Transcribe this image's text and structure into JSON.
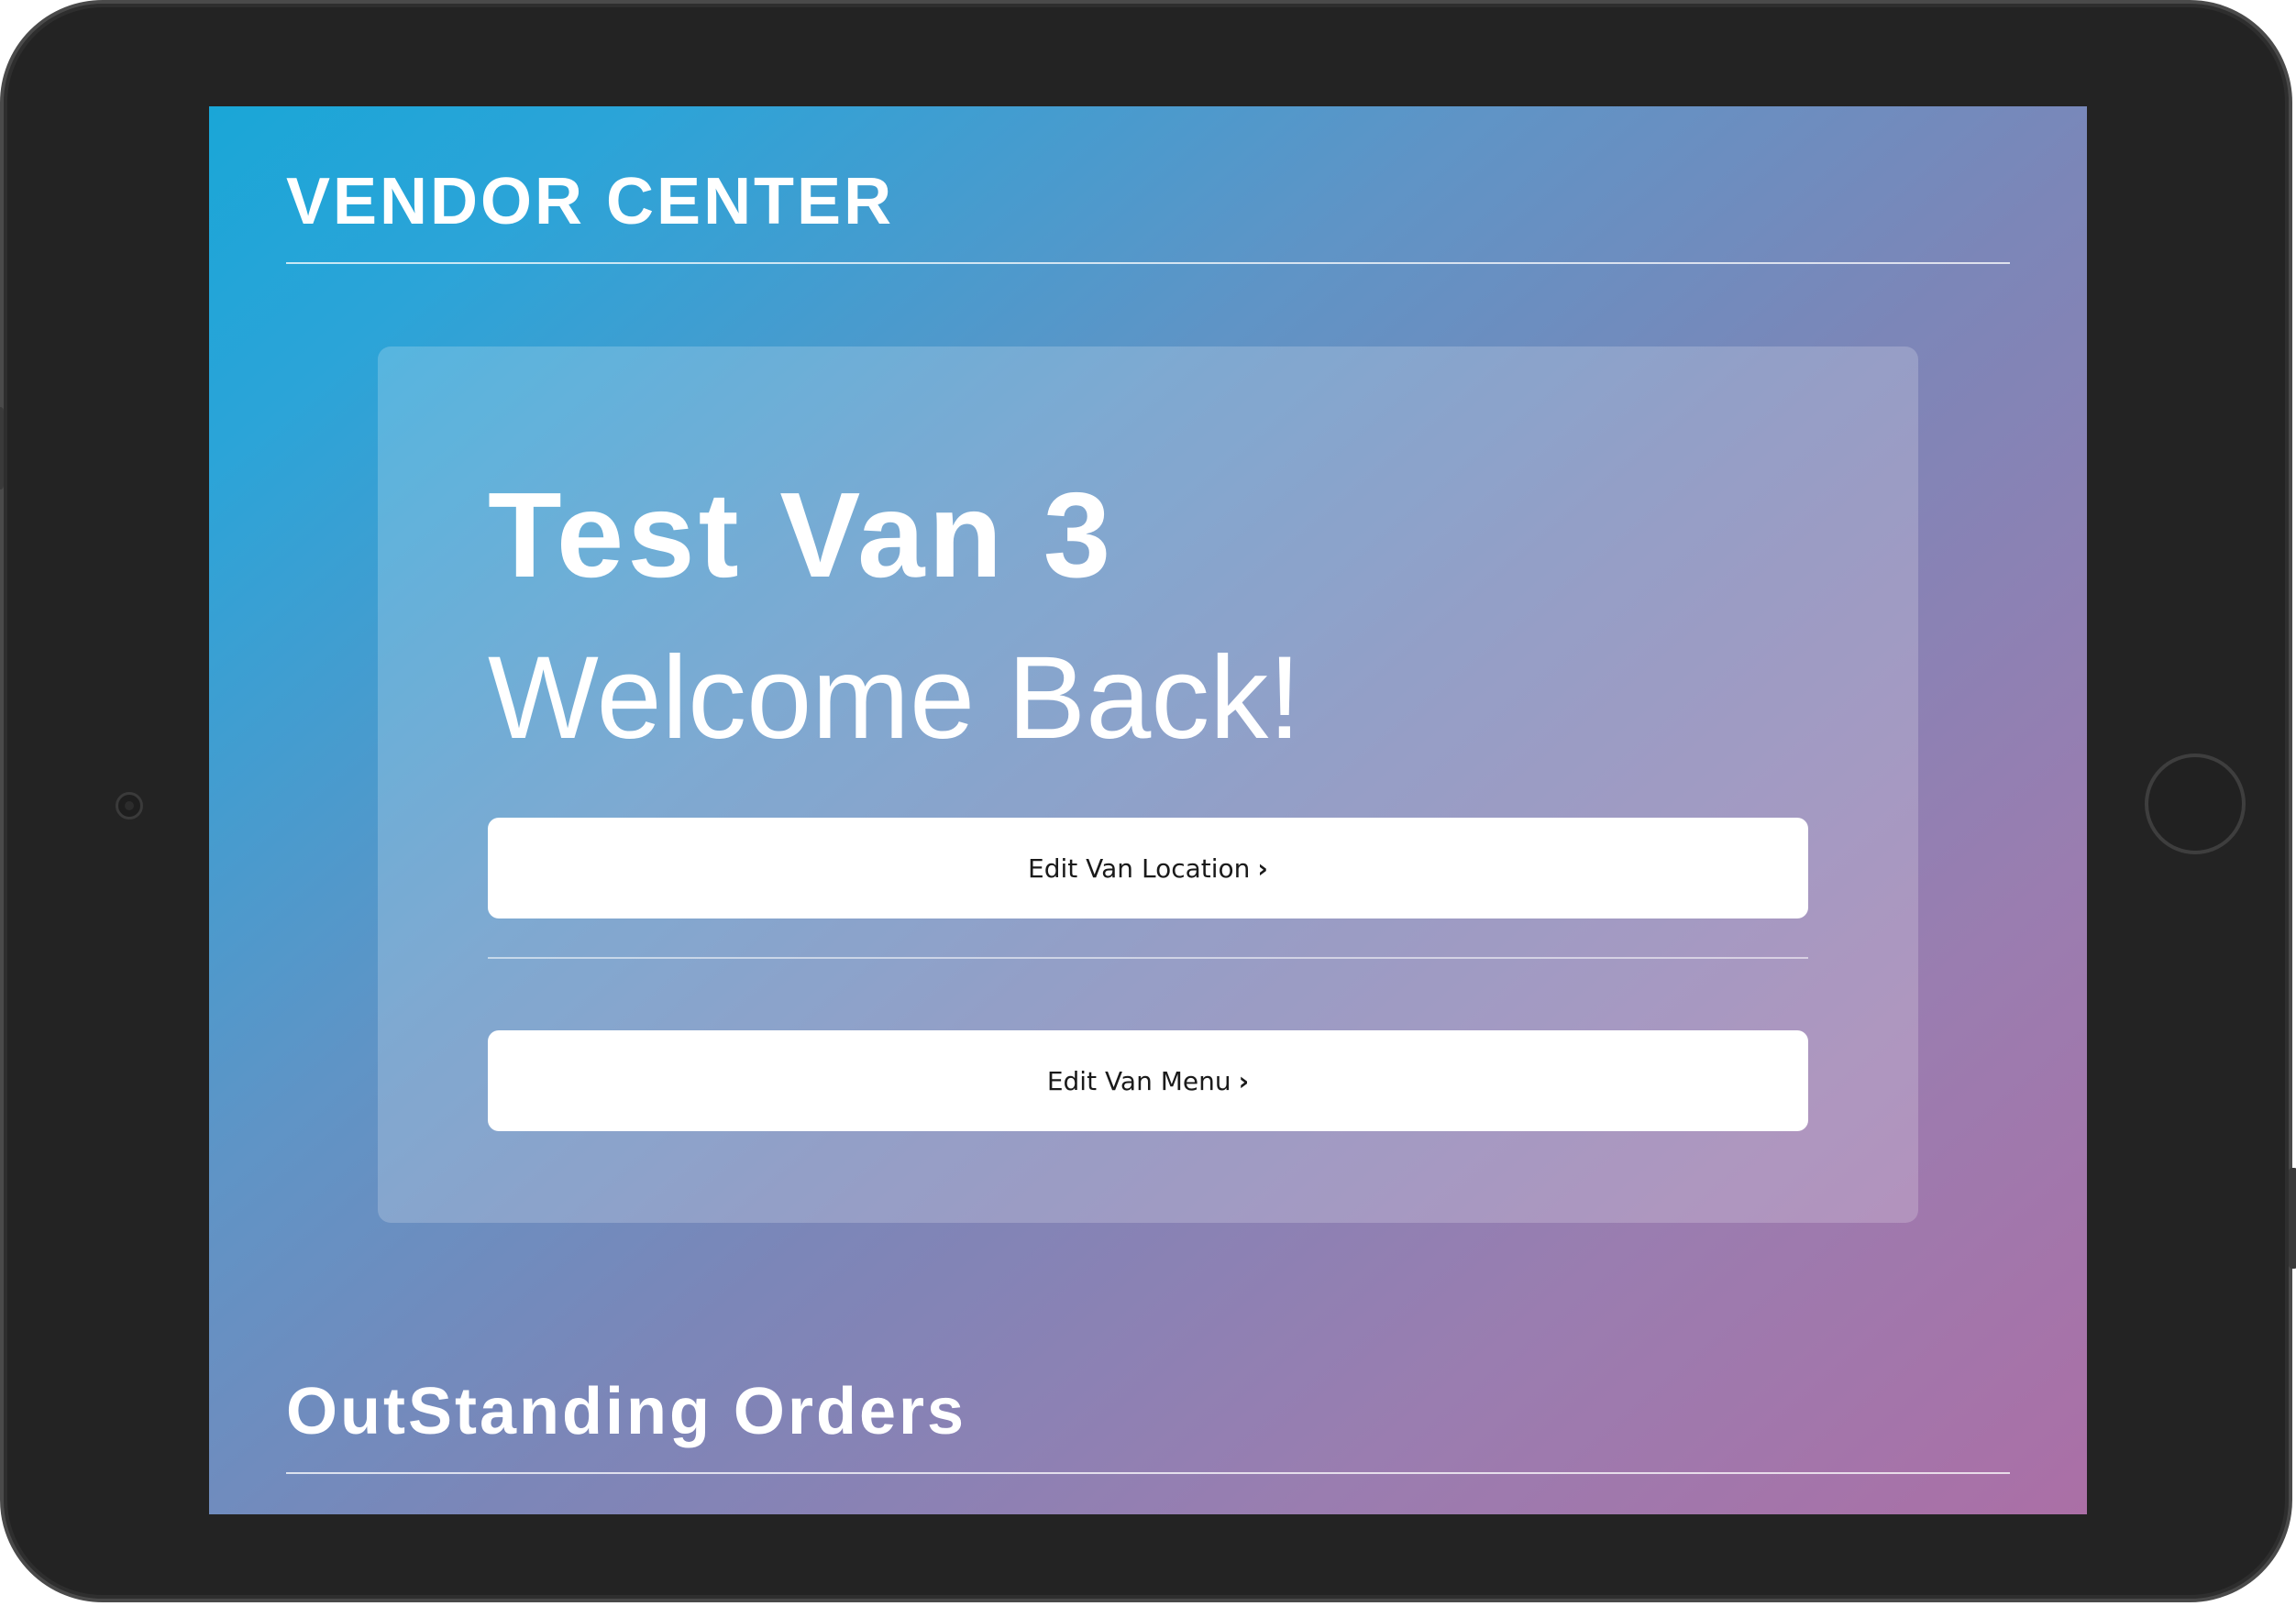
{
  "header": {
    "title": "VENDOR CENTER"
  },
  "welcome_card": {
    "van_name": "Test Van 3",
    "greeting": "Welcome Back!",
    "edit_location_label": "Edit Van Location",
    "edit_menu_label": "Edit Van Menu",
    "chevron": "›"
  },
  "orders_section": {
    "title": "OutStanding Orders"
  },
  "icons": {
    "camera": "front-camera-icon",
    "home": "home-button-icon"
  },
  "colors": {
    "gradient_start": "#1aa6d7",
    "gradient_end": "#ab6fa6",
    "device_frame": "#232323",
    "button_bg": "#ffffff",
    "button_text": "#1a1a1a"
  }
}
